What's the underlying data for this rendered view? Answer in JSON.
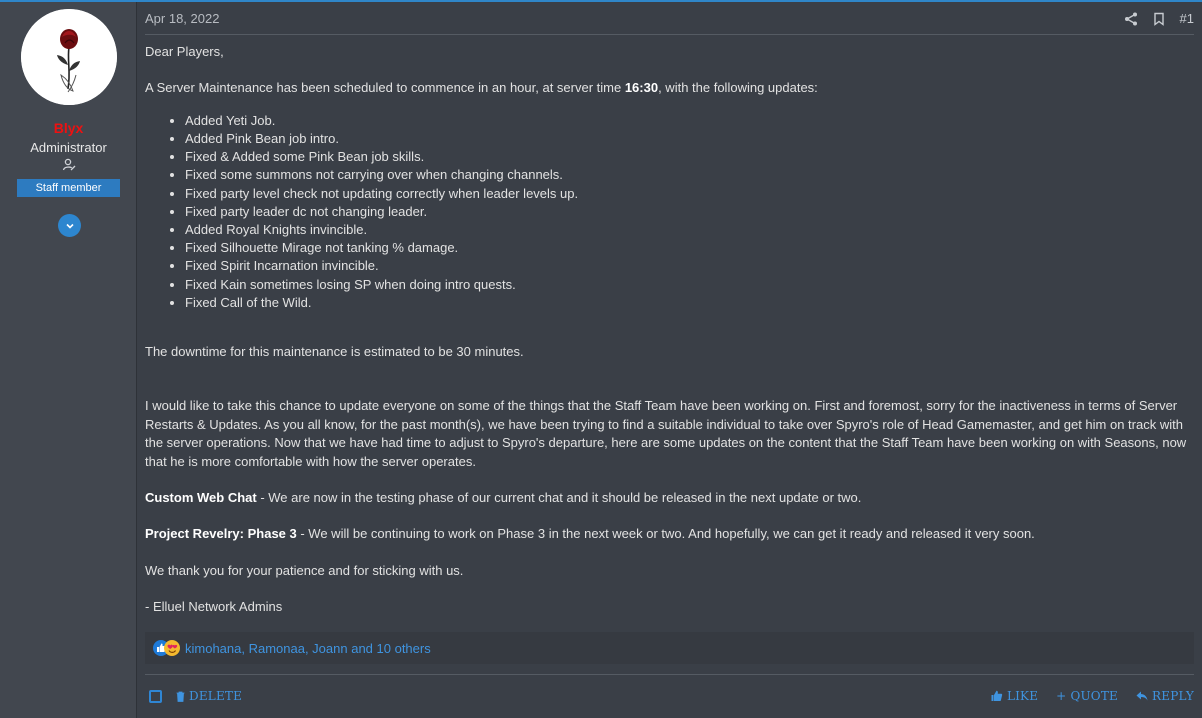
{
  "post": {
    "date": "Apr 18, 2022",
    "number": "#1",
    "author": {
      "name": "Blyx",
      "title": "Administrator",
      "badge": "Staff member"
    },
    "greeting": "Dear Players,",
    "intro_pre": "A Server Maintenance has been scheduled to commence in an hour, at server time ",
    "intro_time": "16:30",
    "intro_post": ", with the following updates:",
    "updates": [
      "Added Yeti Job.",
      "Added Pink Bean job intro.",
      "Fixed & Added some Pink Bean job skills.",
      "Fixed some summons not carrying over when changing channels.",
      "Fixed party level check not updating correctly when leader levels up.",
      "Fixed party leader dc not changing leader.",
      "Added Royal Knights invincible.",
      "Fixed Silhouette Mirage not tanking % damage.",
      "Fixed Spirit Incarnation invincible.",
      "Fixed Kain sometimes losing SP when doing intro quests.",
      "Fixed Call of the Wild."
    ],
    "downtime": "The downtime for this maintenance is estimated to be 30 minutes.",
    "staff_update": "I would like to take this chance to update everyone on some of the things that the Staff Team have been working on. First and foremost, sorry for the inactiveness in terms of Server Restarts & Updates. As you all know, for the past month(s), we have been trying to find a suitable individual to take over Spyro's role of Head Gamemaster, and get him on track with the server operations. Now that we have had time to adjust to Spyro's departure, here are some updates on the content that the Staff Team have been working on with Seasons, now that he is more comfortable with how the server operates.",
    "webchat_title": "Custom Web Chat",
    "webchat_text": " - We are now in the testing phase of our current chat and it should be released in the next update or two.",
    "revelry_title": "Project Revelry: Phase 3",
    "revelry_text": " - We will be continuing to work on Phase 3 in the next week or two. And hopefully, we can get it ready and released it very soon.",
    "thanks": "We thank you for your patience and for sticking with us.",
    "signature": "- Elluel Network Admins",
    "reactions": "kimohana, Ramonaa, Joann and 10 others"
  },
  "actions": {
    "delete": "DELETE",
    "like": "LIKE",
    "quote": "+ QUOTE",
    "reply": "REPLY"
  },
  "icons": {
    "share": "share-icon",
    "bookmark": "bookmark-icon",
    "expand": "chevron-down-icon"
  },
  "colors": {
    "accent": "#2f86c9",
    "username": "#ee1111",
    "link": "#3f94e0"
  }
}
